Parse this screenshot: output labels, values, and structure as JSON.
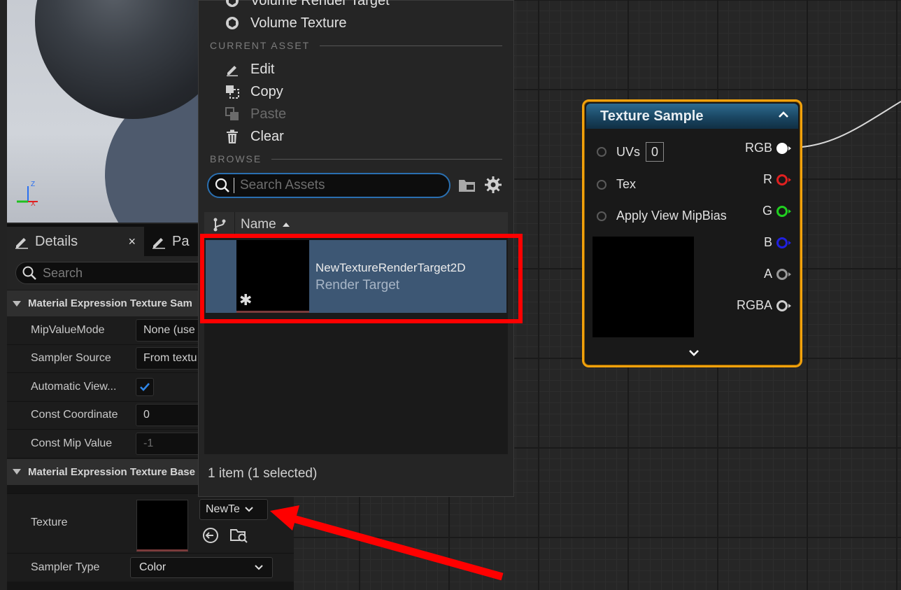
{
  "viewport": {
    "axis_z": "Z",
    "axis_x": "X"
  },
  "details": {
    "tabs": [
      {
        "label": "Details",
        "close": "×"
      },
      {
        "label": "Pa"
      }
    ],
    "search_placeholder": "Search",
    "sections": [
      {
        "title": "Material Expression Texture Sam"
      },
      {
        "title": "Material Expression Texture Base"
      }
    ],
    "props": {
      "mip_value_mode": {
        "label": "MipValueMode",
        "value": "None (use c"
      },
      "sampler_source": {
        "label": "Sampler Source",
        "value": "From textu"
      },
      "automatic_view": {
        "label": "Automatic View...",
        "checked": true
      },
      "const_coordinate": {
        "label": "Const Coordinate",
        "value": "0"
      },
      "const_mip_value": {
        "label": "Const Mip Value",
        "value": "-1"
      },
      "texture": {
        "label": "Texture",
        "value": "NewTe"
      },
      "sampler_type": {
        "label": "Sampler Type",
        "value": "Color"
      }
    }
  },
  "picker": {
    "menu_top": [
      {
        "label": "Volume Render Target",
        "icon": "cube-icon"
      },
      {
        "label": "Volume Texture",
        "icon": "cube-icon"
      }
    ],
    "current_asset_heading": "CURRENT ASSET",
    "current_asset_items": [
      {
        "label": "Edit",
        "icon": "pencil-icon",
        "enabled": true
      },
      {
        "label": "Copy",
        "icon": "copy-icon",
        "enabled": true
      },
      {
        "label": "Paste",
        "icon": "paste-icon",
        "enabled": false
      },
      {
        "label": "Clear",
        "icon": "trash-icon",
        "enabled": true
      }
    ],
    "browse_heading": "BROWSE",
    "search_placeholder": "Search Assets",
    "column_name": "Name",
    "assets": [
      {
        "name": "NewTextureRenderTarget2D",
        "type": "Render Target",
        "selected": true
      }
    ],
    "status": "1 item (1 selected)"
  },
  "node": {
    "title": "Texture Sample",
    "inputs": [
      {
        "label": "UVs",
        "value": "0"
      },
      {
        "label": "Tex"
      },
      {
        "label": "Apply View MipBias"
      }
    ],
    "outputs": [
      {
        "label": "RGB",
        "color": "#ffffff"
      },
      {
        "label": "R",
        "color": "#e02020"
      },
      {
        "label": "G",
        "color": "#20d020"
      },
      {
        "label": "B",
        "color": "#2020e0"
      },
      {
        "label": "A",
        "color": "#9a9a9a"
      },
      {
        "label": "RGBA",
        "color": "#cfcfcf"
      }
    ]
  },
  "colors": {
    "accent_blue": "#2a6fb0",
    "node_border": "#f2a20c",
    "annotation_red": "#ff0000",
    "selection": "#3d5774"
  }
}
